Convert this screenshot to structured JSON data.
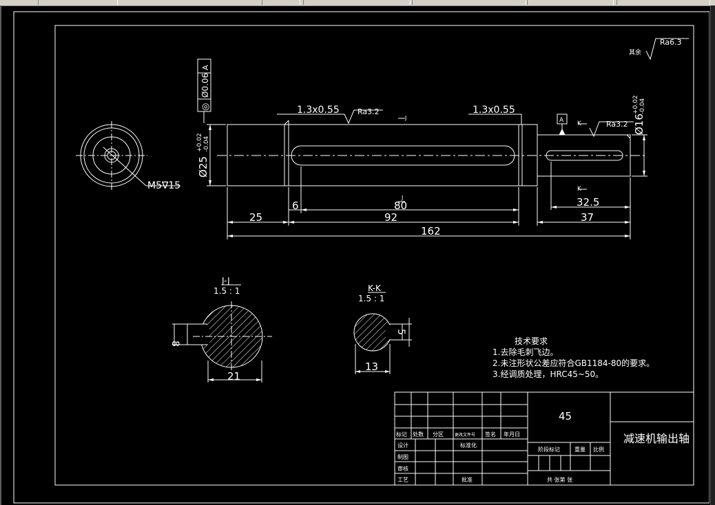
{
  "toolbar": {
    "tabs": [
      "",
      "",
      "",
      "",
      "",
      ""
    ]
  },
  "drawing": {
    "roughness_default": {
      "prefix": "其余",
      "value": "Ra6.3"
    },
    "geometric_tolerance": {
      "symbol": "◎",
      "value": "Ø0.06",
      "datum": "A"
    },
    "diameters": {
      "main": "Ø25",
      "main_upper": "+0.02",
      "main_lower": "-0.04",
      "end": "Ø16",
      "end_upper": "+0.02",
      "end_lower": "-0.04"
    },
    "chamfers": {
      "left": "1.3x0.55",
      "right": "1.3x0.55"
    },
    "roughness_marks": [
      "Ra3.2",
      "Ra3.2"
    ],
    "datum_label": "A",
    "section_marks": {
      "j_top": "J",
      "j_bottom": "J",
      "k_top": "K",
      "k_bottom": "K"
    },
    "center_hole": "M5∇15",
    "dims": {
      "d25": "25",
      "d6": "6",
      "d80": "80",
      "d92": "92",
      "d162": "162",
      "d32_5": "32.5",
      "d37": "37"
    },
    "section_jj": {
      "title": "J-J",
      "scale": "1.5 : 1",
      "width": "8",
      "diameter": "21"
    },
    "section_kk": {
      "title": "K-K",
      "scale": "1.5 : 1",
      "width": "5",
      "diameter": "13"
    },
    "notes": {
      "title": "技术要求",
      "lines": [
        "1.去除毛刺飞边。",
        "2.未注形状公差应符合GB1184-80的要求。",
        "3.经调质处理，HRC45~50。"
      ]
    },
    "title_block": {
      "material": "45",
      "part_name": "减速机输出轴",
      "headers": [
        "标记",
        "处数",
        "分区",
        "更改文件号",
        "签名",
        "年月日"
      ],
      "rows": [
        "设计",
        "制图",
        "审核",
        "工艺"
      ],
      "standardize": "标准化",
      "approve": "批准",
      "stage_mark": "阶段标记",
      "weight": "重量",
      "scale": "比例",
      "sheets": "共  张第  张"
    }
  }
}
